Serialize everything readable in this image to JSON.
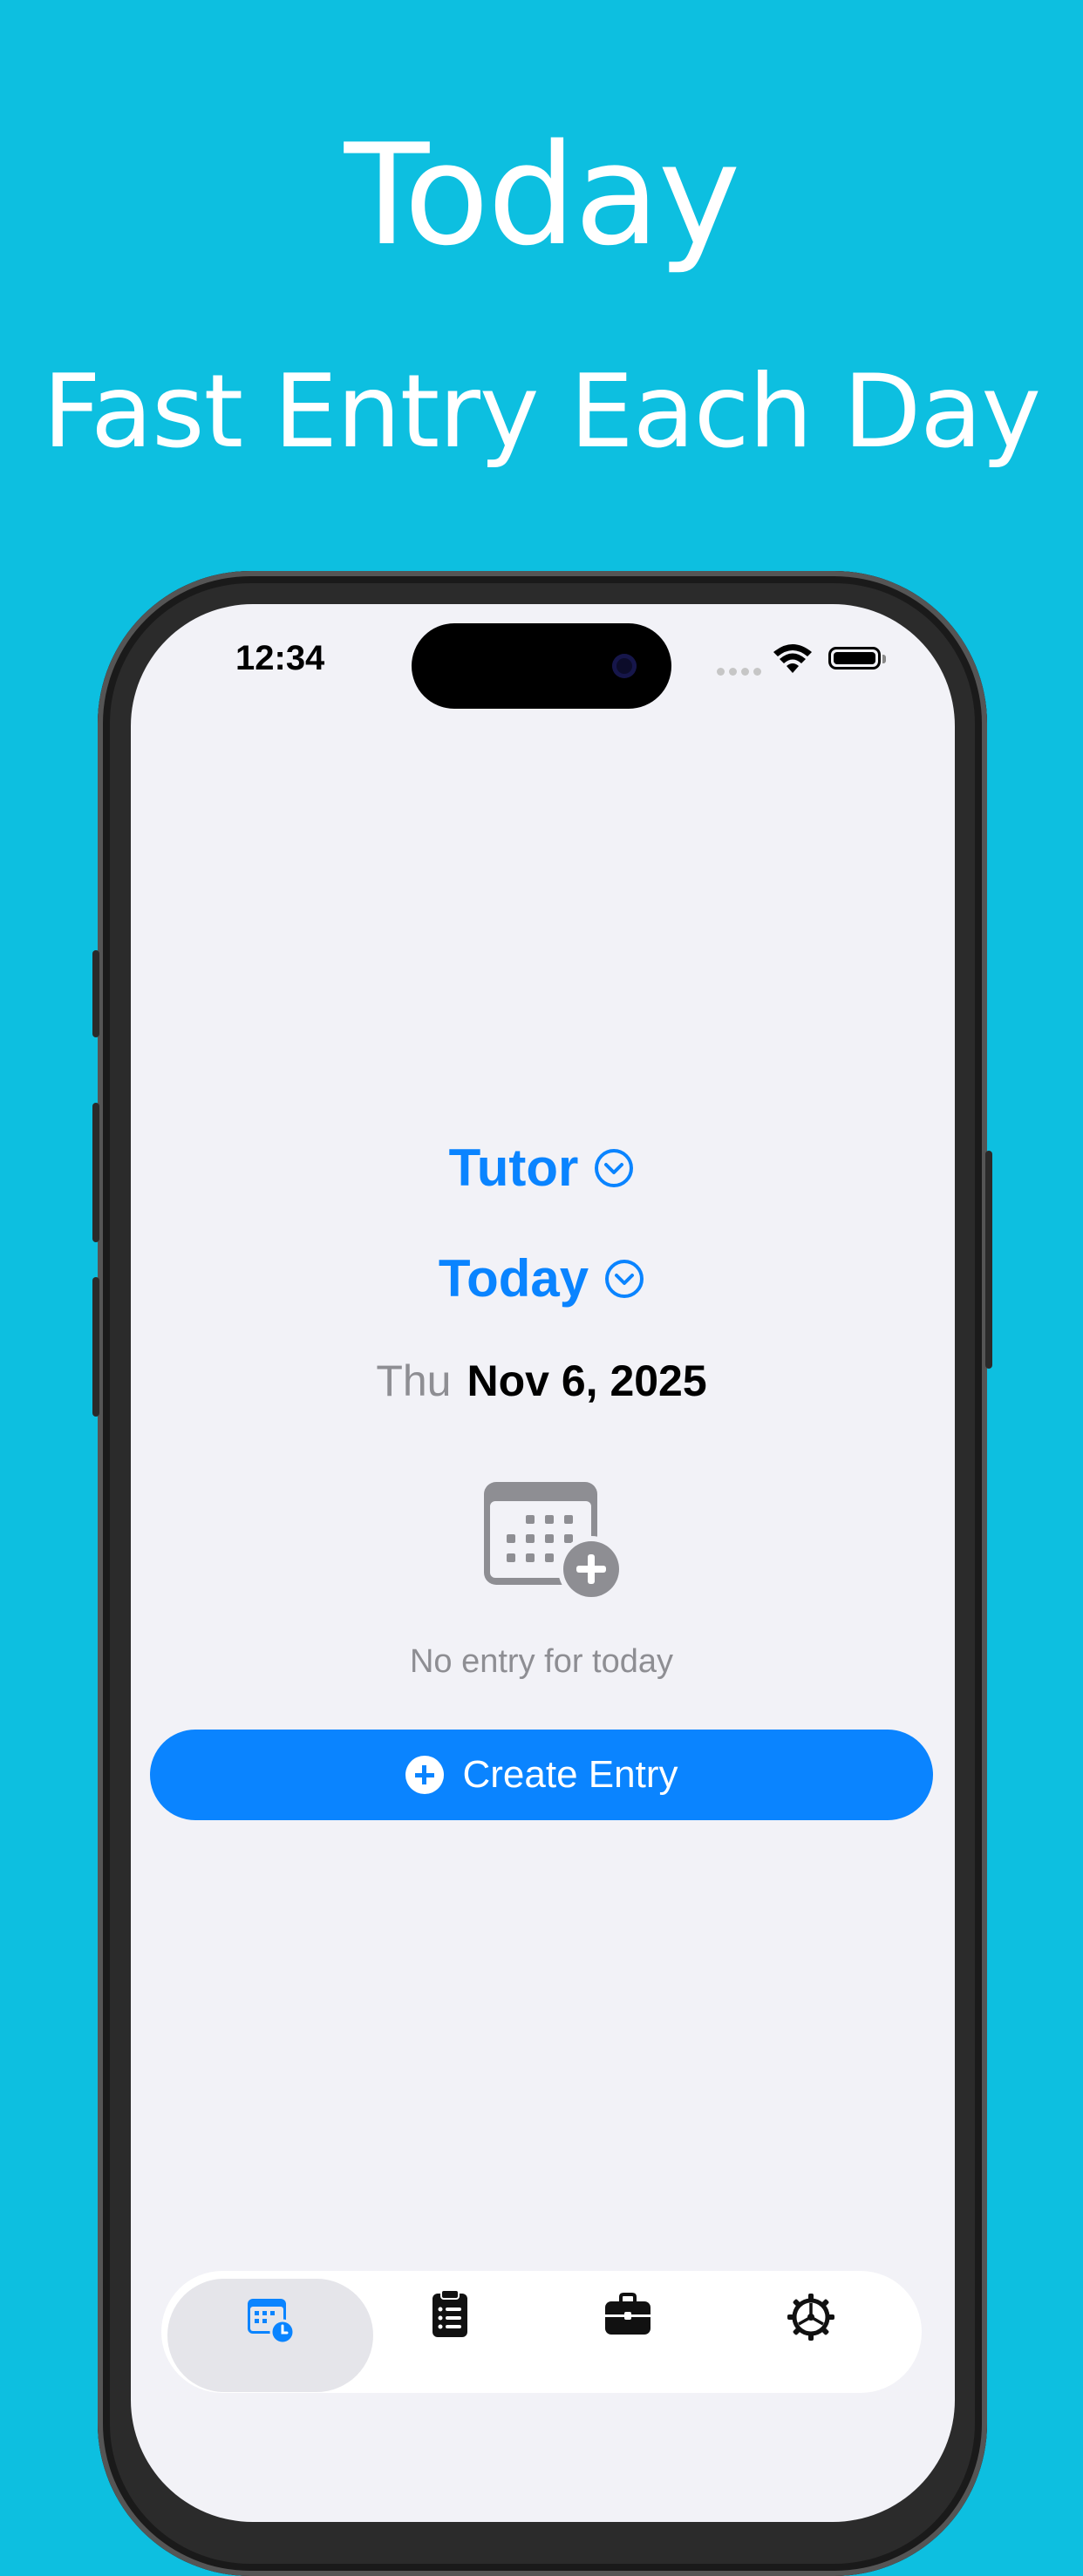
{
  "marketing": {
    "title": "Today",
    "subtitle": "Fast Entry Each Day"
  },
  "status_bar": {
    "time": "12:34"
  },
  "screen": {
    "profile_picker": "Tutor",
    "period_picker": "Today",
    "day_of_week": "Thu",
    "date": "Nov 6, 2025",
    "empty_message": "No entry for today",
    "create_button_label": "Create Entry"
  },
  "tab_bar": {
    "selected": "today",
    "tabs": [
      {
        "id": "today",
        "icon": "calendar-clock-icon"
      },
      {
        "id": "entries",
        "icon": "clipboard-list-icon"
      },
      {
        "id": "jobs",
        "icon": "briefcase-icon"
      },
      {
        "id": "settings",
        "icon": "gear-icon"
      }
    ]
  },
  "colors": {
    "background": "#0DBFE0",
    "accent": "#0A84FF",
    "screen": "#F2F2F7",
    "secondary_text": "#8E8E93"
  }
}
